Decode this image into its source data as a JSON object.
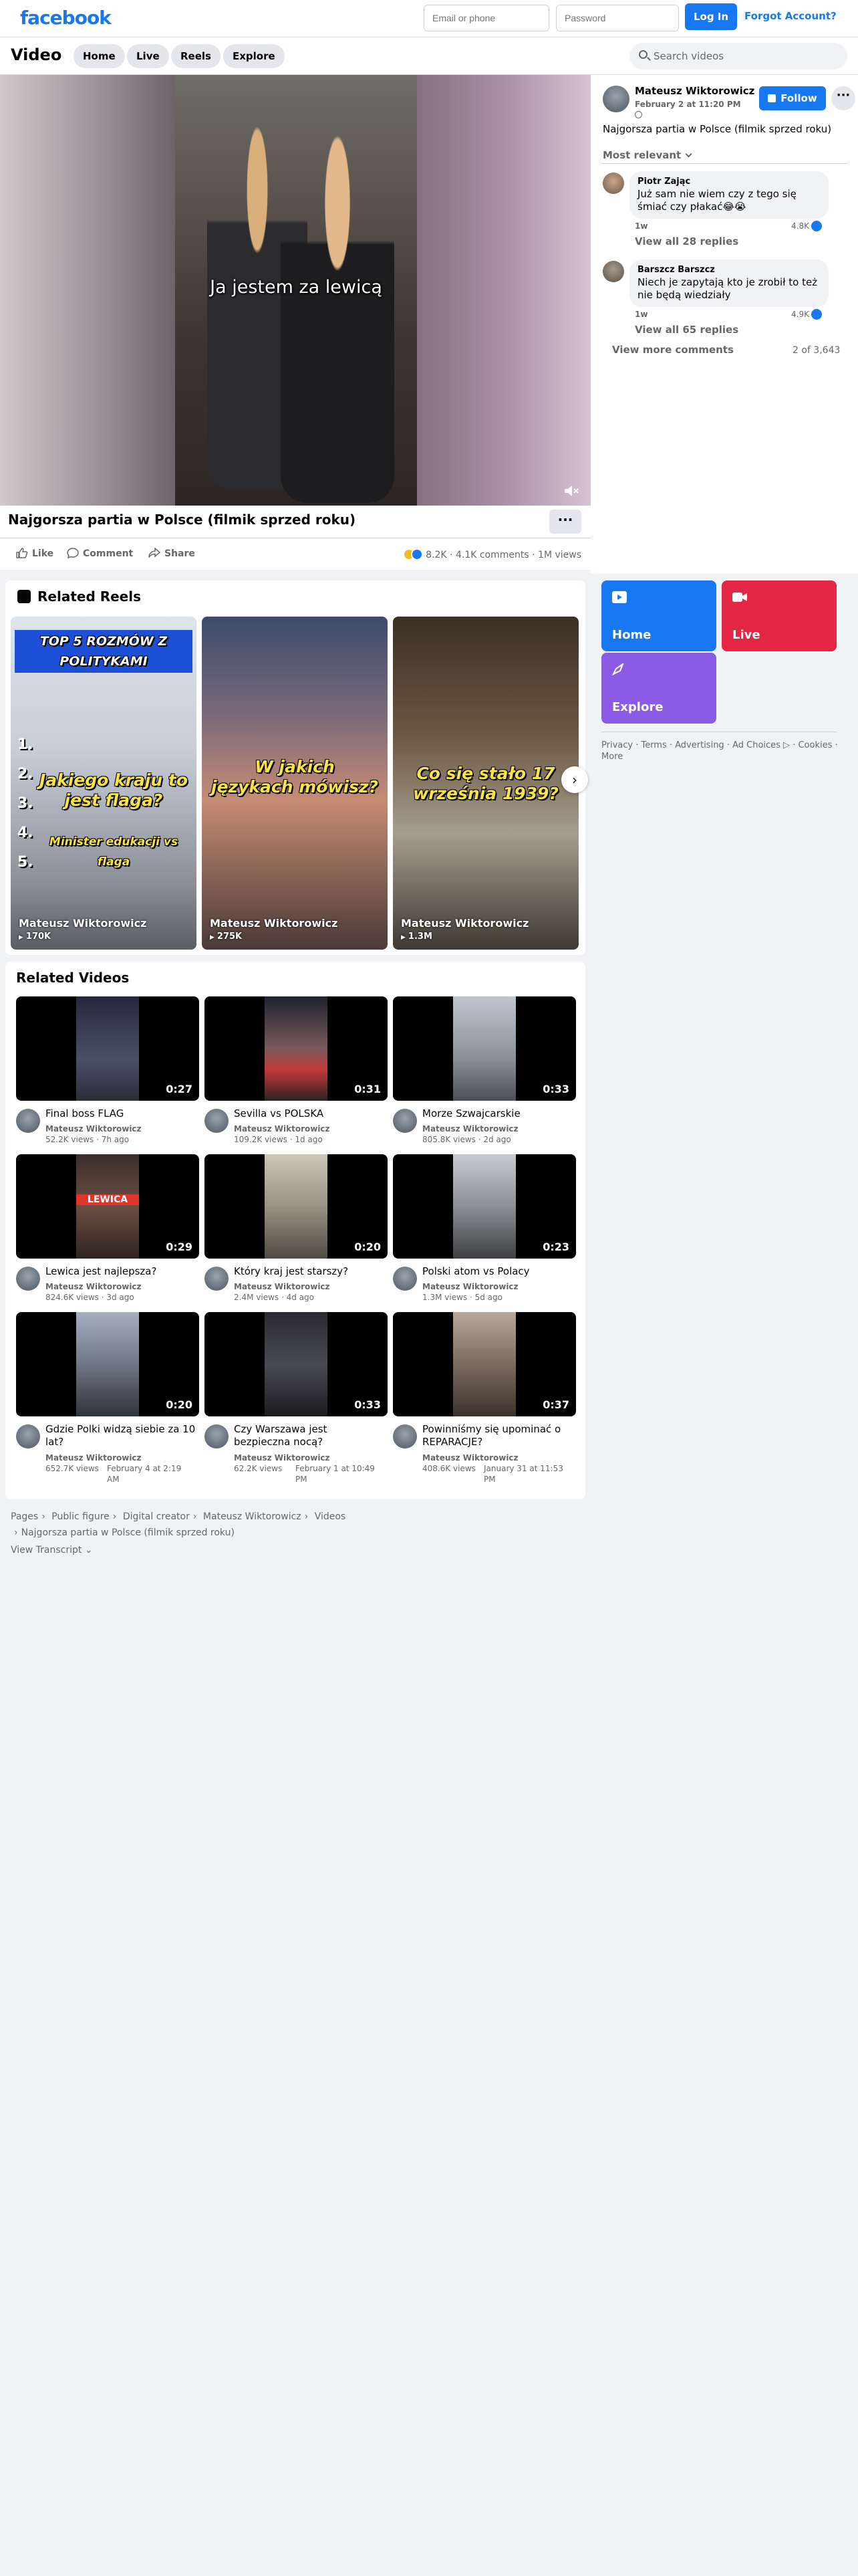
{
  "topbar": {
    "logo": "facebook",
    "email_placeholder": "Email or phone",
    "password_placeholder": "Password",
    "login_label": "Log In",
    "forgot_label": "Forgot Account?"
  },
  "videonav": {
    "title": "Video",
    "tabs": [
      "Home",
      "Live",
      "Reels",
      "Explore"
    ],
    "search_placeholder": "Search videos"
  },
  "player": {
    "subtitle": "Ja jestem za lewicą",
    "title": "Najgorsza partia w Polsce (filmik sprzed roku)",
    "more_label": "···"
  },
  "actions": {
    "like": "Like",
    "comment": "Comment",
    "share": "Share",
    "reactions": "8.2K",
    "comments_count": "4.1K comments",
    "views": "1M views"
  },
  "post": {
    "author": "Mateusz Wiktorowicz",
    "date": "February 2 at 11:20 PM",
    "follow_label": "Follow",
    "dots": "···",
    "text": "Najgorsza partia w Polsce (filmik sprzed roku)",
    "sort_label": "Most relevant"
  },
  "comments": [
    {
      "name": "Piotr Zając",
      "text": "Już sam nie wiem czy z tego się śmiać czy płakać😂😭",
      "time": "1w",
      "likes": "4.8K",
      "replies": "View all 28 replies"
    },
    {
      "name": "Barszcz Barszcz",
      "text": "Niech je zapytają kto je zrobił to też nie będą wiedziały",
      "time": "1w",
      "likes": "4.9K",
      "replies": "View all 65 replies"
    }
  ],
  "comments_footer": {
    "view_more": "View more comments",
    "count": "2 of 3,643"
  },
  "reels": {
    "title": "Related Reels",
    "items": [
      {
        "headline_top": "TOP 5 ROZMÓW Z POLITYKAMI",
        "overlay": "Jakiego kraju to jest flaga?",
        "extra": "Minister edukacji vs flaga",
        "author": "Mateusz Wiktorowicz",
        "views": "170K"
      },
      {
        "overlay": "W jakich językach mówisz?",
        "author": "Mateusz Wiktorowicz",
        "views": "275K"
      },
      {
        "overlay": "Co się stało 17 września 1939?",
        "author": "Mateusz Wiktorowicz",
        "views": "1.3M"
      }
    ],
    "numbers": [
      "1.",
      "2.",
      "3.",
      "4.",
      "5."
    ]
  },
  "sidenav": {
    "tiles": [
      {
        "label": "Home",
        "color": "#1877f2"
      },
      {
        "label": "Live",
        "color": "#e42645"
      },
      {
        "label": "Explore",
        "color": "#8b5be6"
      }
    ],
    "footer": "Privacy · Terms · Advertising · Ad Choices ▷ · Cookies · More"
  },
  "videos": {
    "title": "Related Videos",
    "items": [
      {
        "title": "Final boss FLAG",
        "author": "Mateusz Wiktorowicz",
        "views": "52.2K views",
        "age": "7h ago",
        "duration": "0:27",
        "thumb_text": ""
      },
      {
        "title": "Sevilla vs POLSKA",
        "author": "Mateusz Wiktorowicz",
        "views": "109.2K views",
        "age": "1d ago",
        "duration": "0:31",
        "thumb_text": ""
      },
      {
        "title": "Morze Szwajcarskie",
        "author": "Mateusz Wiktorowicz",
        "views": "805.8K views",
        "age": "2d ago",
        "duration": "0:33",
        "thumb_text": ""
      },
      {
        "title": "Lewica jest najlepsza?",
        "author": "Mateusz Wiktorowicz",
        "views": "824.6K views",
        "age": "3d ago",
        "duration": "0:29",
        "thumb_text": "LEWICA"
      },
      {
        "title": "Który kraj jest starszy?",
        "author": "Mateusz Wiktorowicz",
        "views": "2.4M views",
        "age": "4d ago",
        "duration": "0:20",
        "thumb_text": ""
      },
      {
        "title": "Polski atom vs Polacy",
        "author": "Mateusz Wiktorowicz",
        "views": "1.3M views",
        "age": "5d ago",
        "duration": "0:23",
        "thumb_text": ""
      },
      {
        "title": "Gdzie Polki widzą siebie za 10 lat?",
        "author": "Mateusz Wiktorowicz",
        "views": "652.7K views",
        "age": "February 4 at 2:19 AM",
        "duration": "0:20",
        "thumb_text": ""
      },
      {
        "title": "Czy Warszawa jest bezpieczna nocą?",
        "author": "Mateusz Wiktorowicz",
        "views": "62.2K views",
        "age": "February 1 at 10:49 PM",
        "duration": "0:33",
        "thumb_text": ""
      },
      {
        "title": "Powinniśmy się upominać o REPARACJE?",
        "author": "Mateusz Wiktorowicz",
        "views": "408.6K views",
        "age": "January 31 at 11:53 PM",
        "duration": "0:37",
        "thumb_text": ""
      }
    ]
  },
  "breadcrumbs": [
    "Pages",
    "Public figure",
    "Digital creator",
    "Mateusz Wiktorowicz",
    "Videos",
    "Najgorsza partia w Polsce (filmik sprzed roku)"
  ],
  "transcript_label": "View Transcript"
}
